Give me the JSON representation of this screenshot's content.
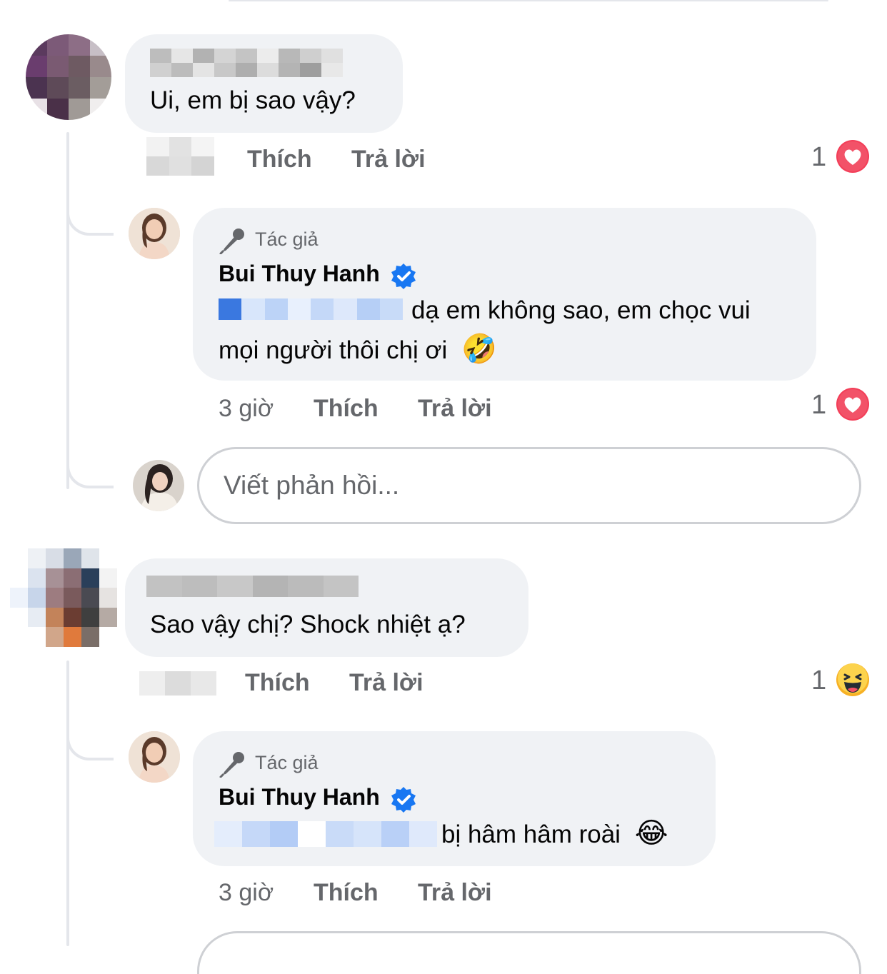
{
  "comments": [
    {
      "text": "Ui, em bị sao vậy?",
      "actions": {
        "like": "Thích",
        "reply": "Trả lời"
      },
      "reaction": {
        "count": "1",
        "type": "love-icon"
      },
      "reply": {
        "author_tag": "Tác giả",
        "author": "Bui Thuy Hanh",
        "text_line1": "dạ em không sao, em chọc vui",
        "text_line2": "mọi người thôi chị ơi",
        "emoji": "🤣",
        "time": "3 giờ",
        "actions": {
          "like": "Thích",
          "reply": "Trả lời"
        },
        "reaction": {
          "count": "1",
          "type": "love-icon"
        }
      },
      "reply_input": {
        "placeholder": "Viết phản hồi..."
      }
    },
    {
      "text": "Sao vậy chị? Shock nhiệt ạ?",
      "actions": {
        "like": "Thích",
        "reply": "Trả lời"
      },
      "reaction": {
        "count": "1",
        "type": "haha-icon"
      },
      "reply": {
        "author_tag": "Tác giả",
        "author": "Bui Thuy Hanh",
        "text_line1": "bị hâm hâm roài",
        "emoji": "😂",
        "time": "3 giờ",
        "actions": {
          "like": "Thích",
          "reply": "Trả lời"
        }
      }
    }
  ],
  "colors": {
    "bubble": "#f0f2f5",
    "secondary_text": "#65676b",
    "verified": "#1877f2",
    "love": "#f33e58",
    "line": "#e4e6eb"
  }
}
